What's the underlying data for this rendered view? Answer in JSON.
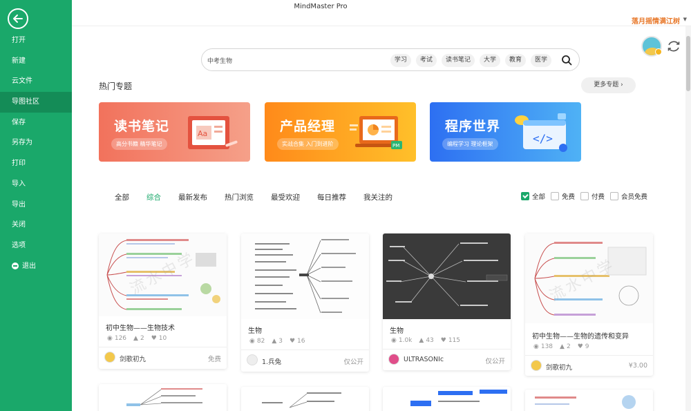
{
  "app": {
    "title": "MindMaster Pro",
    "user_name": "落月摇情满江树"
  },
  "sidebar": {
    "items": [
      {
        "label": "打开"
      },
      {
        "label": "新建"
      },
      {
        "label": "云文件"
      },
      {
        "label": "导图社区",
        "active": true
      },
      {
        "label": "保存"
      },
      {
        "label": "另存为"
      },
      {
        "label": "打印"
      },
      {
        "label": "导入"
      },
      {
        "label": "导出"
      },
      {
        "label": "关闭"
      },
      {
        "label": "选项"
      },
      {
        "label": "退出"
      }
    ]
  },
  "search": {
    "value": "中考生物",
    "tags": [
      "学习",
      "考试",
      "读书笔记",
      "大学",
      "教育",
      "医学"
    ]
  },
  "hot": {
    "title": "热门专题",
    "more": "更多专题",
    "banners": [
      {
        "title": "读书笔记",
        "sub": "高分书籍 精华笔记",
        "art_label": "Aa"
      },
      {
        "title": "产品经理",
        "sub": "实战合集 入门到进阶",
        "art_label": "PM"
      },
      {
        "title": "程序世界",
        "sub": "编程学习 理论框架",
        "art_label": "</>"
      }
    ]
  },
  "tabs": [
    "全部",
    "综合",
    "最新发布",
    "热门浏览",
    "最受欢迎",
    "每日推荐",
    "我关注的"
  ],
  "active_tab": 1,
  "filters": [
    {
      "label": "全部",
      "checked": true
    },
    {
      "label": "免费",
      "checked": false
    },
    {
      "label": "付费",
      "checked": false
    },
    {
      "label": "会员免费",
      "checked": false
    }
  ],
  "cards": [
    {
      "title": "初中生物——生物技术",
      "views": "126",
      "likes": "2",
      "favs": "10",
      "author": "剑歌初九",
      "price": "免费",
      "theme": "light"
    },
    {
      "title": "生物",
      "views": "82",
      "likes": "3",
      "favs": "16",
      "author": "1.兵兔",
      "price": "仅公开",
      "theme": "mono"
    },
    {
      "title": "生物",
      "views": "1.0k",
      "likes": "43",
      "favs": "115",
      "author": "ULTRASONIc",
      "price": "仅公开",
      "theme": "dark"
    },
    {
      "title": "初中生物——生物的遗传和变异",
      "views": "138",
      "likes": "2",
      "favs": "9",
      "author": "剑歌初九",
      "price": "¥3.00",
      "theme": "light"
    }
  ],
  "colors": {
    "brand": "#1aa86a",
    "accent_user": "#e8792b"
  }
}
